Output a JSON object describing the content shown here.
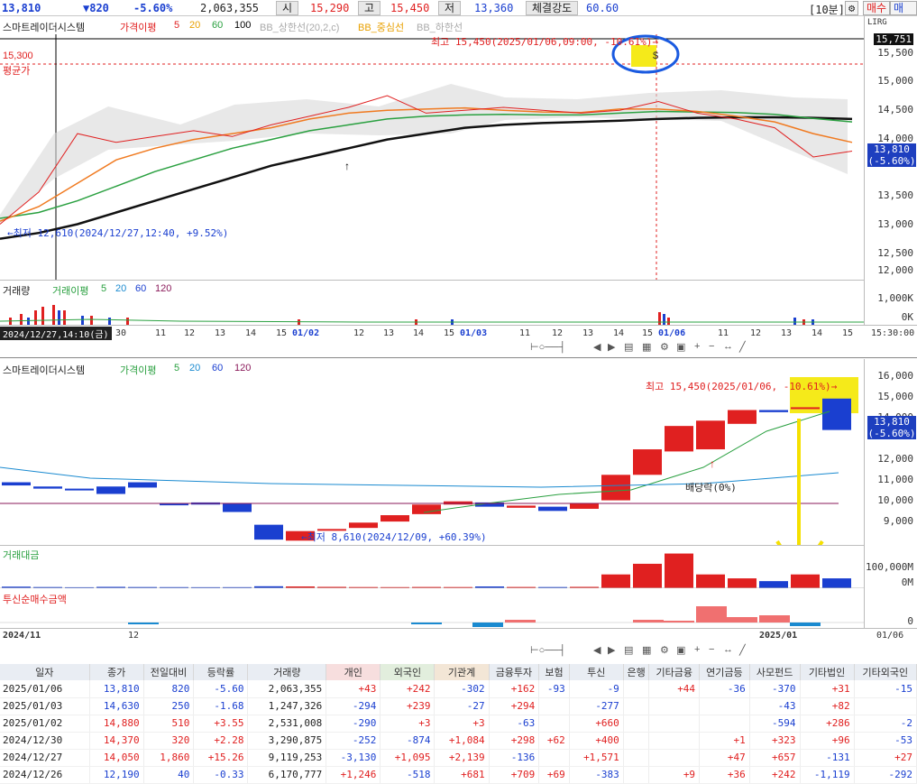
{
  "topbar": {
    "price": "13,810",
    "change": "▼820",
    "change_pct": "-5.60%",
    "volume": "2,063,355",
    "open_label": "시",
    "open": "15,290",
    "high_label": "고",
    "high": "15,450",
    "low_label": "저",
    "low": "13,360",
    "strength_label": "체결강도",
    "strength": "60.60",
    "interval": "[10분]",
    "buy": "매수",
    "sell": "매도"
  },
  "chart1": {
    "legend": {
      "name": "스마트레이더시스템",
      "ma_label": "가격이평",
      "ma5": "5",
      "ma20": "20",
      "ma60": "60",
      "ma100": "100",
      "bb_upper": "BB_상한선(20,2,c)",
      "bb_mid": "BB_중심선",
      "bb_lower": "BB_하한선"
    },
    "high_annot": "최고 15,450(2025/01/06,09:00, -10.61%)→",
    "low_annot": "←최저 12,610(2024/12/27,12:40, +9.52%)",
    "avg_price": "15,300",
    "avg_label": "평균가",
    "ref_price": "15,751",
    "y_ticks": [
      "15,500",
      "15,000",
      "14,500",
      "14,000",
      "13,500",
      "13,000",
      "12,500",
      "12,000"
    ],
    "last_price": "13,810",
    "last_pct": "(-5.60%)",
    "vol_legend": {
      "name": "거래량",
      "ma_label": "거래이평",
      "v5": "5",
      "v20": "20",
      "v60": "60",
      "v120": "120"
    },
    "vol_ticks": [
      "1,000K",
      "0K"
    ],
    "cursor_time": "2024/12/27,14:10(금)",
    "x_labels": [
      "30",
      "11",
      "12",
      "13",
      "14",
      "15",
      "01/02",
      "12",
      "13",
      "14",
      "15",
      "01/03",
      "11",
      "12",
      "13",
      "14",
      "15",
      "01/06",
      "11",
      "12",
      "13",
      "14",
      "15"
    ],
    "x_time": "15:30:00"
  },
  "chart2": {
    "legend": {
      "name": "스마트레이더시스템",
      "ma_label": "가격이평",
      "ma5": "5",
      "ma20": "20",
      "ma60": "60",
      "ma120": "120"
    },
    "high_annot": "최고 15,450(2025/01/06, -10.61%)→",
    "low_annot": "←최저 8,610(2024/12/09, +60.39%)",
    "dividend": "배당락(0%)",
    "y_ticks": [
      "16,000",
      "15,000",
      "14,000",
      "13,000",
      "12,000",
      "11,000",
      "10,000",
      "9,000"
    ],
    "last_price": "13,810",
    "last_pct": "(-5.60%)",
    "amount_label": "거래대금",
    "amount_ticks": [
      "100,000M",
      "0M"
    ],
    "trust_label": "투신순매수금액",
    "trust_ticks": [
      "0"
    ],
    "x_labels": [
      "2024/11",
      "12",
      "2025/01"
    ],
    "x_date": "01/06"
  },
  "table": {
    "headers": [
      "일자",
      "종가",
      "전일대비",
      "등락률",
      "거래량",
      "개인",
      "외국인",
      "기관계",
      "금융투자",
      "보험",
      "투신",
      "은행",
      "기타금융",
      "연기금등",
      "사모펀드",
      "기타법인",
      "기타외국인"
    ],
    "rows": [
      [
        "2025/01/06",
        "13,810",
        "820",
        "-5.60",
        "2,063,355",
        "+43",
        "+242",
        "-302",
        "+162",
        "-93",
        "-9",
        "",
        "+44",
        "-36",
        "-370",
        "+31",
        "-15"
      ],
      [
        "2025/01/03",
        "14,630",
        "250",
        "-1.68",
        "1,247,326",
        "-294",
        "+239",
        "-27",
        "+294",
        "",
        "-277",
        "",
        "",
        "",
        "-43",
        "+82",
        ""
      ],
      [
        "2025/01/02",
        "14,880",
        "510",
        "+3.55",
        "2,531,008",
        "-290",
        "+3",
        "+3",
        "-63",
        "",
        "+660",
        "",
        "",
        "",
        "-594",
        "+286",
        "-2"
      ],
      [
        "2024/12/30",
        "14,370",
        "320",
        "+2.28",
        "3,290,875",
        "-252",
        "-874",
        "+1,084",
        "+298",
        "+62",
        "+400",
        "",
        "",
        "+1",
        "+323",
        "+96",
        "-53"
      ],
      [
        "2024/12/27",
        "14,050",
        "1,860",
        "+15.26",
        "9,119,253",
        "-3,130",
        "+1,095",
        "+2,139",
        "-136",
        "",
        "+1,571",
        "",
        "",
        "+47",
        "+657",
        "-131",
        "+27"
      ],
      [
        "2024/12/26",
        "12,190",
        "40",
        "-0.33",
        "6,170,777",
        "+1,246",
        "-518",
        "+681",
        "+709",
        "+69",
        "-383",
        "",
        "+9",
        "+36",
        "+242",
        "-1,119",
        "-292"
      ]
    ]
  },
  "chart_data": [
    {
      "type": "line",
      "ylim": [
        11700,
        15900
      ],
      "series": [
        {
          "name": "가격이평 5",
          "values": [
            12650,
            13200,
            14200,
            14050,
            14150,
            14250,
            14150,
            14350,
            14500,
            14650,
            14850,
            14550,
            14600,
            14650,
            14600,
            14550,
            14600,
            14750,
            14550,
            14450,
            14300,
            13800,
            13900
          ]
        },
        {
          "name": "20",
          "values": [
            12700,
            12950,
            13350,
            13750,
            13950,
            14100,
            14200,
            14300,
            14450,
            14550,
            14600,
            14620,
            14640,
            14600,
            14570,
            14560,
            14620,
            14620,
            14580,
            14500,
            14400,
            14200,
            14050
          ]
        },
        {
          "name": "60",
          "values": [
            12750,
            12850,
            13050,
            13300,
            13550,
            13750,
            13950,
            14100,
            14250,
            14350,
            14450,
            14500,
            14520,
            14530,
            14520,
            14520,
            14550,
            14580,
            14570,
            14560,
            14530,
            14460,
            14400
          ]
        },
        {
          "name": "100",
          "values": [
            12400,
            12500,
            12650,
            12850,
            13050,
            13250,
            13450,
            13650,
            13800,
            13950,
            14100,
            14200,
            14300,
            14350,
            14380,
            14400,
            14420,
            14450,
            14470,
            14480,
            14480,
            14470,
            14450
          ]
        }
      ]
    },
    {
      "type": "bar",
      "ylim": [
        8400,
        16300
      ],
      "categories": [
        "1",
        "2",
        "3",
        "4",
        "5",
        "6",
        "7",
        "8",
        "9",
        "10",
        "11",
        "12",
        "13",
        "14",
        "15",
        "16",
        "17",
        "18",
        "19",
        "20",
        "21",
        "22",
        "23",
        "24",
        "25",
        "26",
        "27"
      ],
      "series": [
        {
          "name": "open",
          "values": [
            11350,
            11150,
            11050,
            11150,
            11350,
            10350,
            10400,
            10350,
            9350,
            8600,
            9100,
            9200,
            9500,
            9850,
            10300,
            10400,
            10150,
            10200,
            10100,
            10500,
            11700,
            12800,
            12900,
            14100,
            14750,
            14800,
            15290
          ]
        },
        {
          "name": "close",
          "values": [
            11200,
            11050,
            11000,
            10800,
            11100,
            10300,
            10300,
            9950,
            8650,
            9050,
            9150,
            9450,
            9800,
            10300,
            10450,
            10200,
            10250,
            10000,
            10350,
            11700,
            12900,
            14000,
            14250,
            14750,
            14650,
            14880,
            13810
          ]
        }
      ]
    },
    {
      "type": "bar",
      "categories": [
        "1",
        "2",
        "3",
        "4",
        "5",
        "6",
        "7",
        "8",
        "9",
        "10",
        "11",
        "12",
        "13",
        "14",
        "15",
        "16",
        "17",
        "18",
        "19",
        "20",
        "21",
        "22",
        "23",
        "24",
        "25",
        "26",
        "27"
      ],
      "series": [
        {
          "name": "거래대금",
          "values": [
            4000,
            3000,
            2500,
            3500,
            3000,
            2800,
            2600,
            2700,
            5000,
            4500,
            3500,
            3000,
            2800,
            3200,
            3000,
            4500,
            3200,
            3000,
            3500,
            35000,
            62000,
            88000,
            35000,
            25000,
            18000,
            35000,
            25000
          ]
        }
      ]
    }
  ]
}
